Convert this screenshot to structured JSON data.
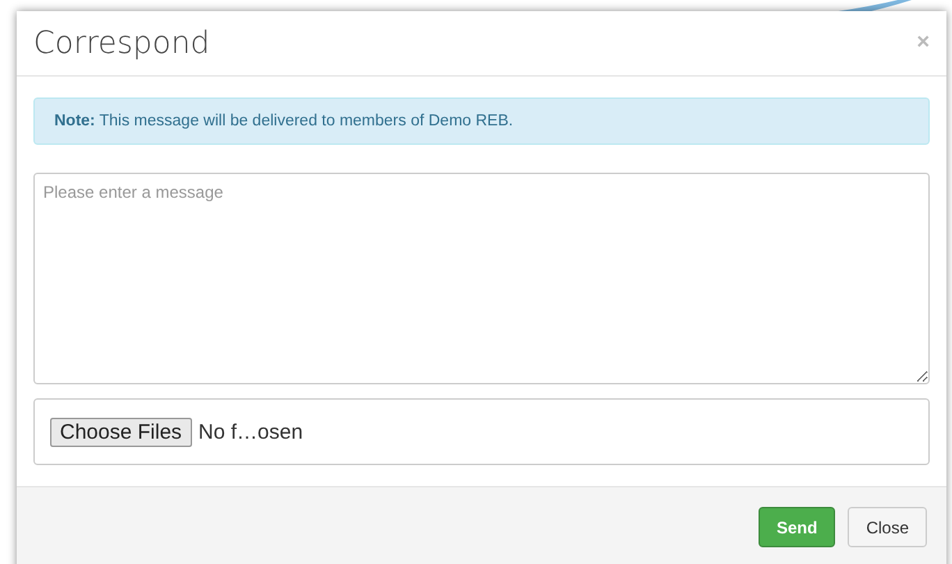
{
  "dialog": {
    "title": "Correspond",
    "close_icon": "×"
  },
  "note": {
    "text": "**Note:** This message will be delivered to members of Demo REB."
  },
  "message": {
    "placeholder": "Please enter a message"
  },
  "file_input": {
    "button": "Choose Files",
    "status": "No f…osen"
  },
  "buttons": [
    {
      "label": "Send",
      "kind": "primary"
    },
    {
      "label": "Close",
      "kind": "default"
    }
  ]
}
